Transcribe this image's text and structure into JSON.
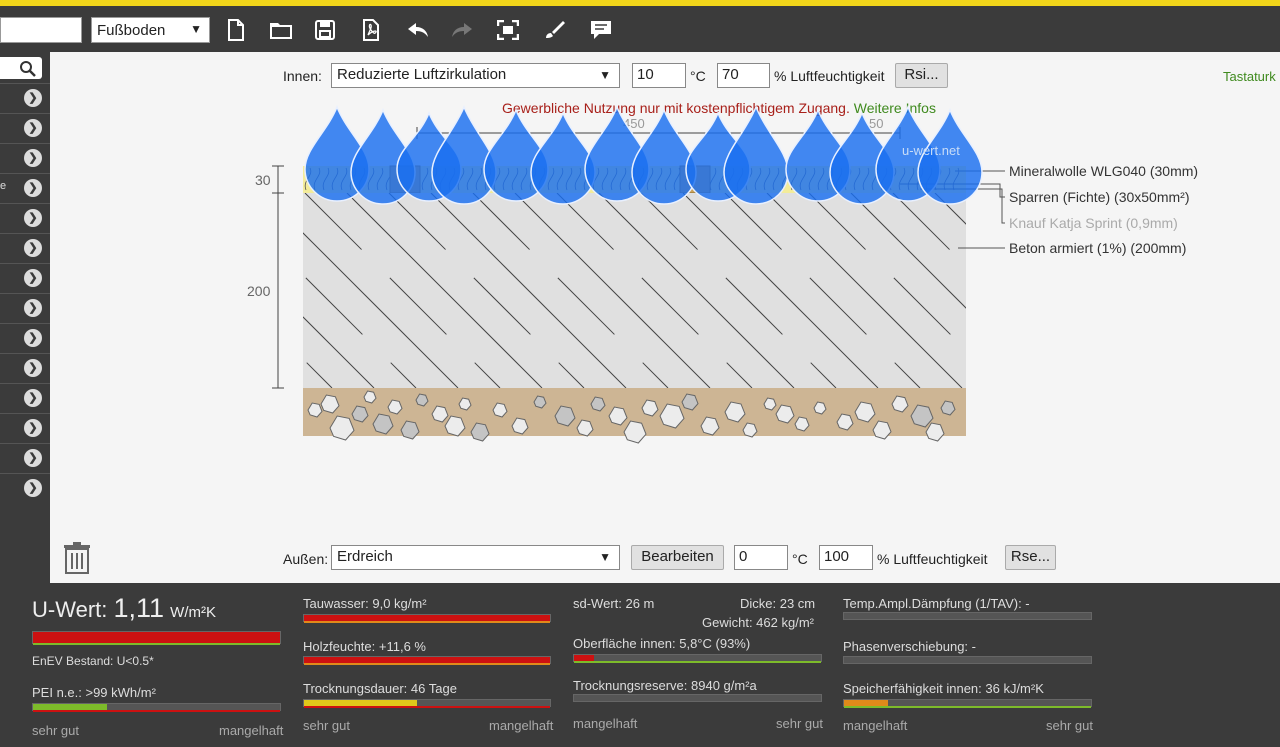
{
  "toolbar": {
    "component_type": "Fußboden",
    "icons": [
      "new-file-icon",
      "open-folder-icon",
      "save-icon",
      "pdf-export-icon",
      "undo-icon",
      "redo-icon",
      "fit-screen-icon",
      "brush-icon",
      "comment-icon"
    ]
  },
  "sidebar": {
    "search_icon": "search-icon",
    "rows": 14,
    "row_fragment": "e"
  },
  "interior": {
    "label": "Innen:",
    "ventilation": "Reduzierte Luftzirkulation",
    "temperature": "10",
    "temp_unit": "°C",
    "humidity": "70",
    "humidity_unit": "% Luftfeuchtigkeit",
    "rsi_button": "Rsi..."
  },
  "exterior": {
    "label": "Außen:",
    "medium": "Erdreich",
    "edit_button": "Bearbeiten",
    "temperature": "0",
    "temp_unit": "°C",
    "humidity": "100",
    "humidity_unit": "% Luftfeuchtigkeit",
    "rse_button": "Rse..."
  },
  "tastatur_link": "Tastaturk",
  "notice": {
    "text": "Gewerbliche Nutzung nur mit kostenpflichtigem Zugang.",
    "link": "Weitere Infos"
  },
  "diagram": {
    "watermark": "u-wert.net",
    "dim_top_left": "450",
    "dim_top_right": "50",
    "dim_30": "30",
    "dim_200": "200",
    "layers": [
      {
        "label": "Mineralwolle WLG040 (30mm)",
        "muted": false
      },
      {
        "label": "Sparren (Fichte) (30x50mm²)",
        "muted": false
      },
      {
        "label": "Knauf Katja Sprint (0,9mm)",
        "muted": true
      },
      {
        "label": "Beton armiert (1%) (200mm)",
        "muted": false
      }
    ]
  },
  "results": {
    "u_label": "U-Wert:",
    "u_value": "1,11",
    "u_unit": "W/m²K",
    "enev": "EnEV Bestand: U<0.5*",
    "pei": "PEI n.e.: >99 kWh/m²",
    "tauwasser": "Tauwasser: 9,0 kg/m²",
    "holzfeuchte": "Holzfeuchte: +11,6 %",
    "trocknungsdauer": "Trocknungsdauer: 46 Tage",
    "sd_wert": "sd-Wert: 26 m",
    "dicke": "Dicke: 23 cm",
    "gewicht": "Gewicht: 462 kg/m²",
    "oberflaeche": "Oberfläche innen: 5,8°C (93%)",
    "trocknungsreserve": "Trocknungsreserve: 8940 g/m²a",
    "temp_ampl": "Temp.Ampl.Dämpfung (1/TAV): -",
    "phasen": "Phasenverschiebung: -",
    "speicher": "Speicherfähigkeit innen: 36 kJ/m²K",
    "sehr_gut": "sehr gut",
    "mangelhaft": "mangelhaft",
    "levels": {
      "u_wert": 1.0,
      "pei": 0.3,
      "tauwasser": 1.0,
      "holzfeuchte": 1.0,
      "trocknungsdauer": 0.46,
      "oberflaeche": 0.08,
      "speicher": 0.18
    },
    "colors": {
      "bad": "#cc1111",
      "good": "#7dbb2a",
      "mid": "#e0c81a",
      "orange": "#e08a1a"
    }
  }
}
